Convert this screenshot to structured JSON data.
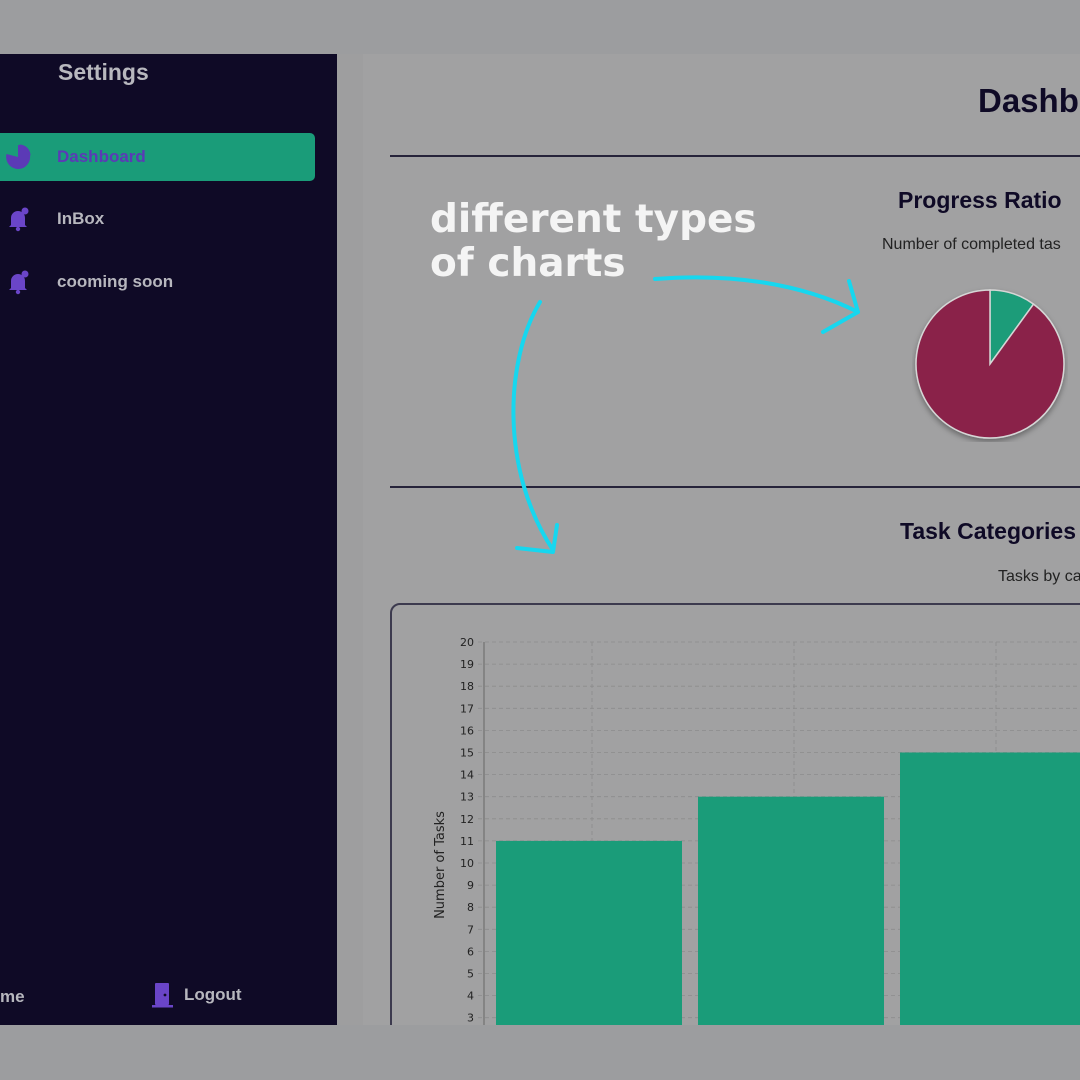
{
  "sidebar": {
    "title": "Settings",
    "items": [
      {
        "label": "Dashboard",
        "icon": "pie-chart-icon",
        "active": true
      },
      {
        "label": "InBox",
        "icon": "bell-icon",
        "active": false
      },
      {
        "label": "cooming soon",
        "icon": "bell-icon",
        "active": false
      }
    ],
    "footer_left_label": "me",
    "logout_label": "Logout"
  },
  "main": {
    "page_title": "Dashb",
    "progress": {
      "title": "Progress Ratio",
      "subtitle": "Number of completed tas"
    },
    "categories": {
      "title": "Task Categories",
      "subtitle": "Tasks by ca"
    }
  },
  "annotation": {
    "line1": "different types",
    "line2": "of charts"
  },
  "colors": {
    "accent": "#1a9c79",
    "sidebar_bg": "#0f0a26",
    "pie_red": "#8a2449",
    "pie_green": "#1a9c79",
    "annotation_arrow": "#16d7ef"
  },
  "chart_data": [
    {
      "type": "pie",
      "values": [
        10,
        90
      ],
      "colors": [
        "#1a9c79",
        "#8a2449"
      ]
    },
    {
      "type": "bar",
      "ylabel": "Number of Tasks",
      "ylim": [
        0,
        20
      ],
      "yticks": [
        3,
        4,
        5,
        6,
        7,
        8,
        9,
        10,
        11,
        12,
        13,
        14,
        15,
        16,
        17,
        18,
        19,
        20
      ],
      "values": [
        11,
        13,
        15
      ],
      "grid": true
    }
  ]
}
